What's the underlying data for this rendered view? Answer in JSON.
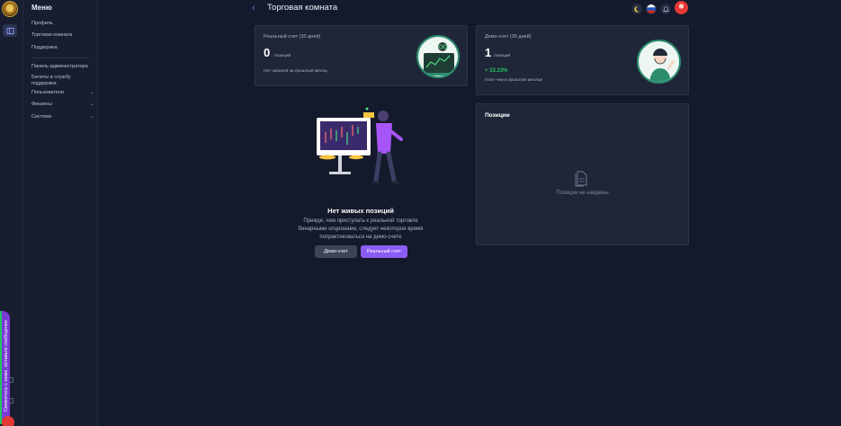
{
  "sidebar": {
    "title": "Меню",
    "items": [
      {
        "label": "Профиль"
      },
      {
        "label": "Торговая комната"
      },
      {
        "label": "Поддержка"
      },
      {
        "label": "Панель администратора"
      },
      {
        "label": "Билеты в службу поддержки"
      },
      {
        "label": "Пользователи"
      },
      {
        "label": "Финансы"
      },
      {
        "label": "Система"
      }
    ]
  },
  "feedback": {
    "label": "Свяжитесь с нами, оставьте сообщение"
  },
  "header": {
    "title": "Торговая комната",
    "icons": [
      "moon-icon",
      "russia-flag-icon",
      "bell-icon",
      "user-avatar"
    ]
  },
  "real_account": {
    "label": "Реальный счет (30 дней)",
    "count": "0",
    "unit": "позиций",
    "note": "Нет записей за прошлый месяц."
  },
  "demo_account": {
    "label": "Демо-счет (30 дней)",
    "count": "1",
    "unit": "позиций",
    "change": "+ 33.33%",
    "note": "more чем в прошлом месяце"
  },
  "positions": {
    "title": "Позиции",
    "empty_text": "Позиции не найдены"
  },
  "empty_state": {
    "title": "Нет живых позиций",
    "description": "Прежде, чем приступать к реальной торговле бинарными опционами, следует некоторое время попрактиковаться на демо-счете",
    "demo_button": "Демо-счет",
    "real_button": "Реальный счет"
  },
  "colors": {
    "background": "#141a2b",
    "card": "#1f2638",
    "accent": "#8b5cf6",
    "positive": "#22c55e"
  }
}
